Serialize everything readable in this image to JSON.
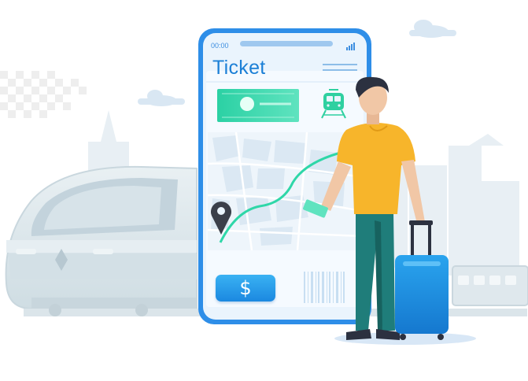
{
  "phone": {
    "status_time": "00:00",
    "title": "Ticket",
    "pay_button_label": "$"
  },
  "colors": {
    "phone_frame": "#2e8ee8",
    "screen_bg": "#eaf4fd",
    "ticket_green": "#2fd0a0",
    "route_green": "#2fd7a8",
    "shirt": "#f7b52b",
    "pants": "#1f7d7a",
    "suitcase": "#1a8fe0",
    "train": "#dde7ec",
    "skyline": "#e6eef4"
  },
  "icons": [
    "train-icon",
    "map-pin-icon",
    "dollar-icon",
    "signal-icon",
    "menu-icon"
  ]
}
